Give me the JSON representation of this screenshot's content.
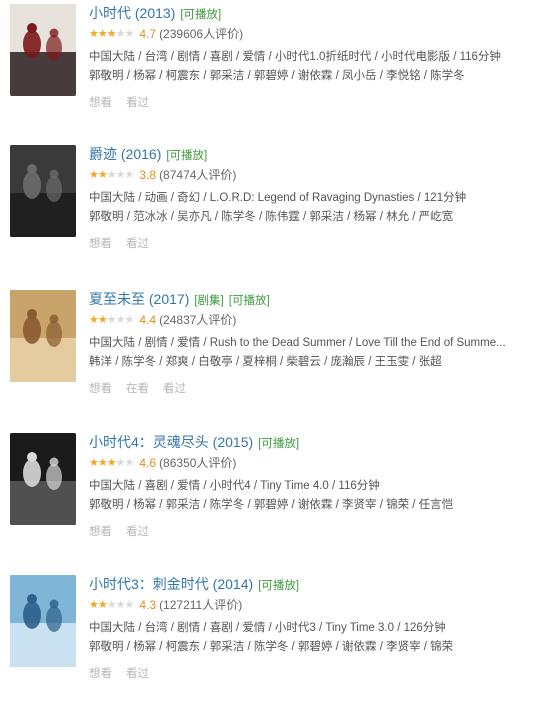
{
  "movies": [
    {
      "title": "小时代 (2013)",
      "tags": [
        "[可播放]"
      ],
      "rating": 4.7,
      "rating_text": "4.7",
      "stars_filled": 2.5,
      "votes_text": "(239606人评价)",
      "meta_line_1": "中国大陆 / 台湾 / 剧情 / 喜剧 / 爱情 / 小时代1.0折纸时代 / 小时代电影版 / 116分钟",
      "meta_line_2": "郭敬明 / 杨幂 / 柯震东 / 郭采洁 / 郭碧婷 / 谢依霖 / 凤小岳 / 李悦铭 / 陈学冬",
      "actions": [
        "想看",
        "看过"
      ],
      "poster_colors": [
        "#e8e2dc",
        "#7a1a1a",
        "#2a1e1e"
      ]
    },
    {
      "title": "爵迹 (2016)",
      "tags": [
        "[可播放]"
      ],
      "rating": 3.8,
      "rating_text": "3.8",
      "stars_filled": 2,
      "votes_text": "(87474人评价)",
      "meta_line_1": "中国大陆 / 动画 / 奇幻 / L.O.R.D: Legend of Ravaging Dynasties / 121分钟",
      "meta_line_2": "郭敬明 / 范冰冰 / 吴亦凡 / 陈学冬 / 陈伟霆 / 郭采洁 / 杨幂 / 林允 / 严屹宽",
      "actions": [
        "想看",
        "看过"
      ],
      "poster_colors": [
        "#3a3a3a",
        "#6b6b6b",
        "#1c1c1c"
      ]
    },
    {
      "title": "夏至未至 (2017)",
      "tags": [
        "[剧集]",
        "[可播放]"
      ],
      "rating": 4.4,
      "rating_text": "4.4",
      "stars_filled": 2,
      "votes_text": "(24837人评价)",
      "meta_line_1": "中国大陆 / 剧情 / 爱情 / Rush to the Dead Summer / Love Till the End of Summe...",
      "meta_line_2": "韩洋 / 陈学冬 / 郑爽 / 白敬亭 / 夏梓桐 / 柴碧云 / 庞瀚辰 / 王玉雯 / 张超",
      "actions": [
        "想看",
        "在看",
        "看过"
      ],
      "poster_colors": [
        "#c9a46a",
        "#8a5a2e",
        "#e8d3a8"
      ]
    },
    {
      "title": "小时代4：灵魂尽头 (2015)",
      "tags": [
        "[可播放]"
      ],
      "rating": 4.6,
      "rating_text": "4.6",
      "stars_filled": 2.5,
      "votes_text": "(86350人评价)",
      "meta_line_1": "中国大陆 / 喜剧 / 爱情 / 小时代4 / Tiny Time 4.0 / 116分钟",
      "meta_line_2": "郭敬明 / 杨幂 / 郭采洁 / 陈学冬 / 郭碧婷 / 谢依霖 / 李贤宰 / 锦荣 / 任言恺",
      "actions": [
        "想看",
        "看过"
      ],
      "poster_colors": [
        "#1a1a1a",
        "#d8d8d8",
        "#5a5a5a"
      ]
    },
    {
      "title": "小时代3：刺金时代 (2014)",
      "tags": [
        "[可播放]"
      ],
      "rating": 4.3,
      "rating_text": "4.3",
      "stars_filled": 2,
      "votes_text": "(127211人评价)",
      "meta_line_1": "中国大陆 / 台湾 / 剧情 / 喜剧 / 爱情 / 小时代3 / Tiny Time 3.0 / 126分钟",
      "meta_line_2": "郭敬明 / 杨幂 / 柯震东 / 郭采洁 / 陈学冬 / 郭碧婷 / 谢依霖 / 李贤宰 / 锦荣",
      "actions": [
        "想看",
        "看过"
      ],
      "poster_colors": [
        "#7fb6d8",
        "#2e5f8a",
        "#d6e9f5"
      ]
    }
  ],
  "colors": {
    "title_link": "#3377aa",
    "tag_green": "#3c9a3c",
    "star_on": "#f5a623",
    "star_off": "#d9d9d9",
    "score": "#e09015",
    "muted": "#b7b7b7"
  }
}
